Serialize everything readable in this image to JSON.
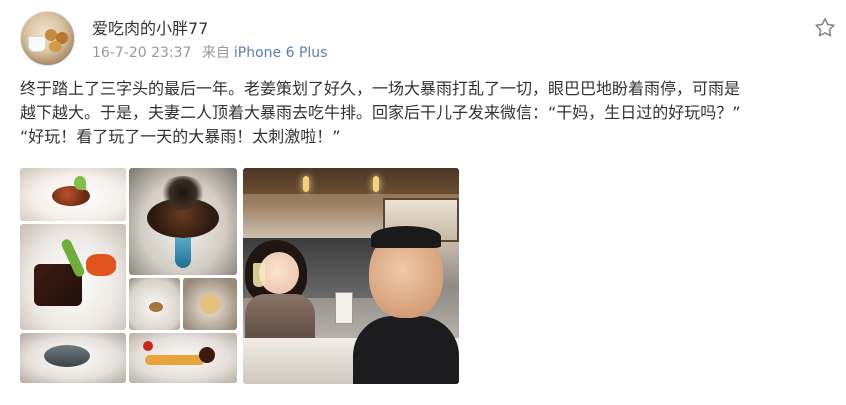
{
  "post": {
    "username": "爱吃肉的小胖77",
    "date": "16-7-20 23:37",
    "source_prefix": "来自",
    "device": "iPhone 6 Plus",
    "text": "终于踏上了三字头的最后一年。老姜策划了好久，一场大暴雨打乱了一切，眼巴巴地盼着雨停，可雨是\n越下越大。于是，夫妻二人顶着大暴雨去吃牛排。回家后干儿子发来微信：“干妈，生日过的好玩吗？”\n“好玩！看了玩了一天的大暴雨！太刺激啦！”"
  },
  "icons": {
    "favorite": "star-outline-icon"
  },
  "colors": {
    "text": "#333333",
    "meta": "#999999",
    "link": "#5b7fb1"
  }
}
